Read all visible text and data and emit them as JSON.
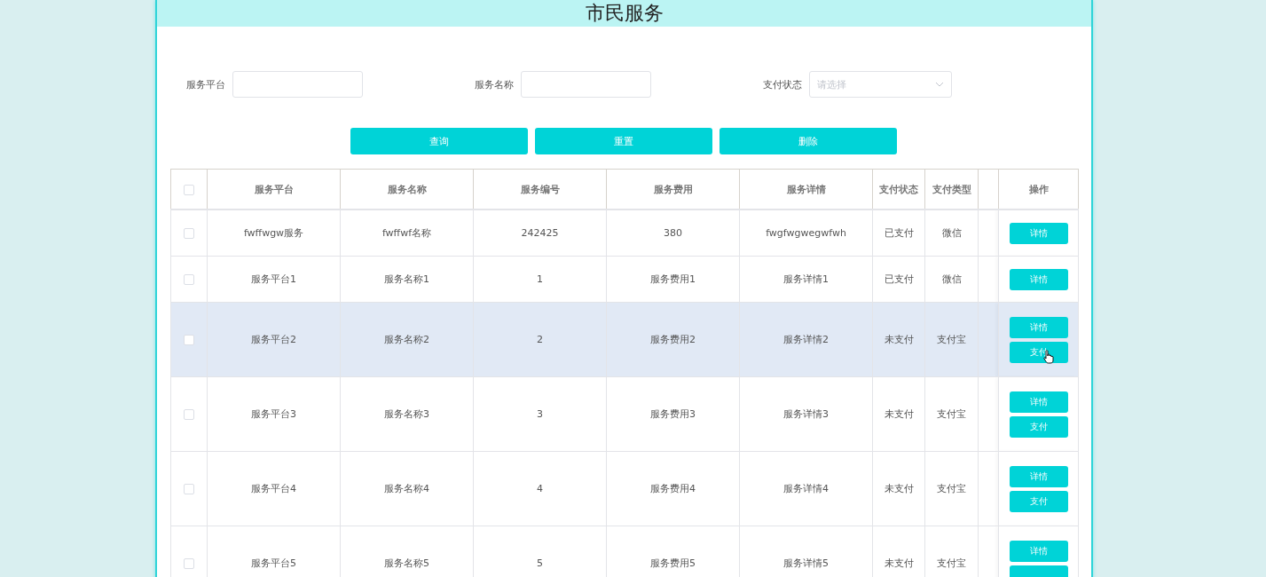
{
  "title": "市民服务",
  "filters": [
    {
      "label": "服务平台",
      "kind": "text"
    },
    {
      "label": "服务名称",
      "kind": "text"
    },
    {
      "label": "支付状态",
      "kind": "select",
      "placeholder": "请选择"
    }
  ],
  "buttons": [
    "查询",
    "重置",
    "删除"
  ],
  "table": {
    "header_checked": false,
    "columns": [
      "服务平台",
      "服务名称",
      "服务编号",
      "服务费用",
      "服务详情",
      "支付状态",
      "支付类型",
      "",
      "操作"
    ],
    "rows": [
      {
        "checked": false,
        "hovered": false,
        "cells": [
          "fwffwgw服务",
          "fwffwf名称",
          "242425",
          "380",
          "fwgfwgwegwfwh",
          "已支付",
          "微信"
        ],
        "actions": [
          {
            "label": "详情",
            "pointer": false
          }
        ]
      },
      {
        "checked": false,
        "hovered": false,
        "cells": [
          "服务平台1",
          "服务名称1",
          "1",
          "服务费用1",
          "服务详情1",
          "已支付",
          "微信"
        ],
        "actions": [
          {
            "label": "详情",
            "pointer": false
          }
        ]
      },
      {
        "checked": false,
        "hovered": true,
        "cells": [
          "服务平台2",
          "服务名称2",
          "2",
          "服务费用2",
          "服务详情2",
          "未支付",
          "支付宝"
        ],
        "actions": [
          {
            "label": "详情",
            "pointer": false
          },
          {
            "label": "支付",
            "pointer": true
          }
        ]
      },
      {
        "checked": false,
        "hovered": false,
        "cells": [
          "服务平台3",
          "服务名称3",
          "3",
          "服务费用3",
          "服务详情3",
          "未支付",
          "支付宝"
        ],
        "actions": [
          {
            "label": "详情",
            "pointer": false
          },
          {
            "label": "支付",
            "pointer": false
          }
        ]
      },
      {
        "checked": false,
        "hovered": false,
        "cells": [
          "服务平台4",
          "服务名称4",
          "4",
          "服务费用4",
          "服务详情4",
          "未支付",
          "支付宝"
        ],
        "actions": [
          {
            "label": "详情",
            "pointer": false
          },
          {
            "label": "支付",
            "pointer": false
          }
        ]
      },
      {
        "checked": false,
        "hovered": false,
        "cells": [
          "服务平台5",
          "服务名称5",
          "5",
          "服务费用5",
          "服务详情5",
          "未支付",
          "支付宝"
        ],
        "actions": [
          {
            "label": "详情",
            "pointer": false
          },
          {
            "pointer": false
          }
        ]
      }
    ]
  }
}
